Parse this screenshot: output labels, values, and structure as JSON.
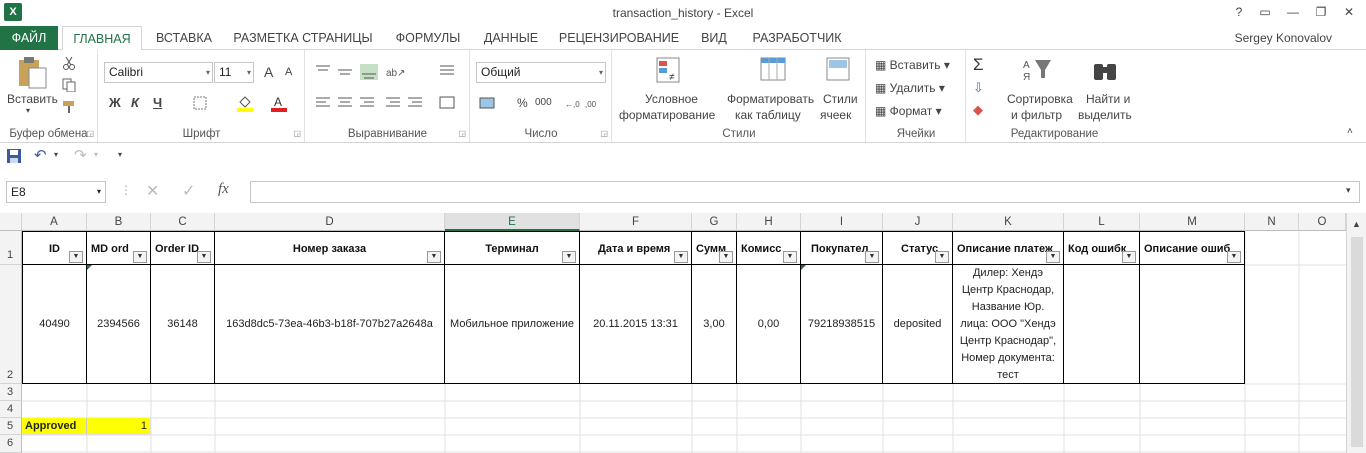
{
  "window": {
    "title": "transaction_history - Excel",
    "help": "?",
    "user": "Sergey Konovalov",
    "app_icon": "X"
  },
  "tabs": [
    {
      "label": "ФАЙЛ"
    },
    {
      "label": "ГЛАВНАЯ"
    },
    {
      "label": "ВСТАВКА"
    },
    {
      "label": "РАЗМЕТКА СТРАНИЦЫ"
    },
    {
      "label": "ФОРМУЛЫ"
    },
    {
      "label": "ДАННЫЕ"
    },
    {
      "label": "РЕЦЕНЗИРОВАНИЕ"
    },
    {
      "label": "ВИД"
    },
    {
      "label": "РАЗРАБОТЧИК"
    }
  ],
  "ribbon": {
    "clipboard": {
      "label": "Буфер обмена",
      "paste": "Вставить"
    },
    "font": {
      "label": "Шрифт",
      "name": "Calibri",
      "size": "11",
      "bold": "Ж",
      "italic": "К",
      "underline": "Ч",
      "grow": "A",
      "shrink": "A"
    },
    "alignment": {
      "label": "Выравнивание"
    },
    "number": {
      "label": "Число",
      "format": "Общий",
      "percent": "%",
      "thousands": "000"
    },
    "styles": {
      "label": "Стили",
      "conditional": [
        "Условное",
        "форматирование"
      ],
      "as_table": [
        "Форматировать",
        "как таблицу"
      ],
      "cell_styles": [
        "Стили",
        "ячеек"
      ]
    },
    "cells": {
      "label": "Ячейки",
      "insert": "Вставить",
      "delete": "Удалить",
      "format": "Формат"
    },
    "editing": {
      "label": "Редактирование",
      "sort": [
        "Сортировка",
        "и фильтр"
      ],
      "find": [
        "Найти и",
        "выделить"
      ]
    }
  },
  "formula_bar": {
    "name_box": "E8",
    "fx": "fx",
    "value": ""
  },
  "columns": [
    "A",
    "B",
    "C",
    "D",
    "E",
    "F",
    "G",
    "H",
    "I",
    "J",
    "K",
    "L",
    "M",
    "N",
    "O"
  ],
  "selected_column": "E",
  "rows": [
    "1",
    "2",
    "3",
    "4",
    "5",
    "6"
  ],
  "headers": [
    "ID",
    "MD ord",
    "Order ID",
    "Номер заказа",
    "Терминал",
    "Дата и время",
    "Сумм",
    "Комисс",
    "Покупател",
    "Статус",
    "Описание платеж",
    "Код ошибк",
    "Описание ошиб"
  ],
  "record": [
    "40490",
    "2394566",
    "36148",
    "163d8dc5-73ea-46b3-b18f-707b27a2648a",
    "Мобильное приложение",
    "20.11.2015 13:31",
    "3,00",
    "0,00",
    "79218938515",
    "deposited",
    "Дилер: Хендэ Центр Краснодар, Название Юр. лица: ООО \"Хендэ Центр Краснодар\", Номер документа: тест",
    "",
    ""
  ],
  "approved": {
    "label": "Approved",
    "value": "1",
    "highlight": "#ffff00"
  },
  "colors": {
    "accent": "#217346",
    "filter_bg": "#f4f4f4",
    "highlight": "#ffff00"
  },
  "icons": [
    "excel-icon",
    "save-icon",
    "undo-icon",
    "redo-icon",
    "paste-icon",
    "cut-icon",
    "copy-icon",
    "format-painter-icon",
    "fill-color-icon",
    "font-color-icon",
    "borders-icon",
    "sum-icon",
    "fill-down-icon",
    "clear-icon",
    "sort-filter-icon",
    "find-icon",
    "cancel-icon",
    "enter-icon",
    "fx-icon",
    "filter-icon"
  ]
}
